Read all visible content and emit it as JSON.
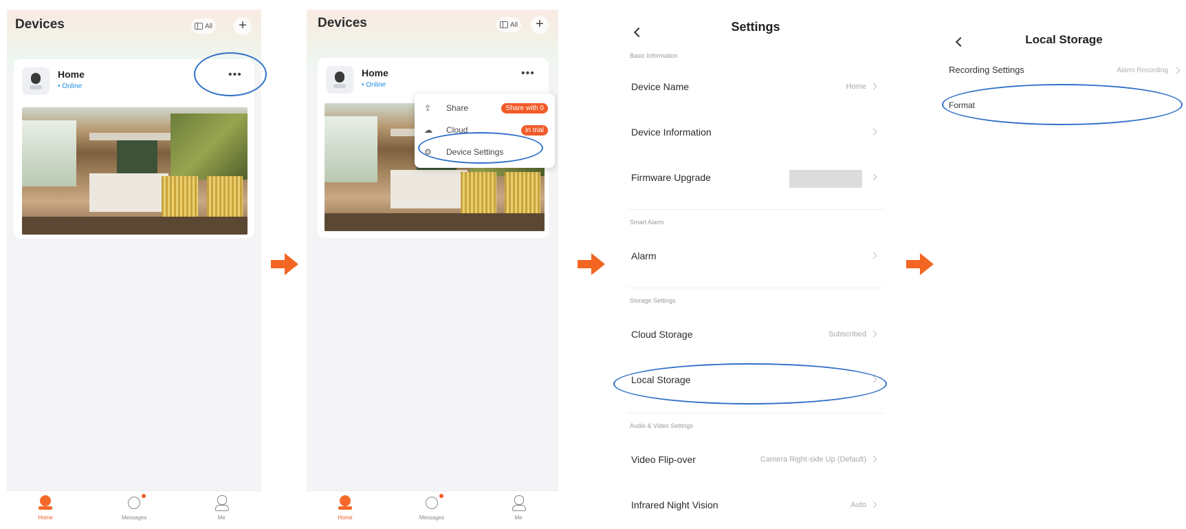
{
  "devices_screen": {
    "title": "Devices",
    "all_label": "All",
    "device": {
      "name": "Home",
      "status": "• Online"
    },
    "tabs": [
      {
        "label": "Home",
        "active": true,
        "icon": "home-camera-icon"
      },
      {
        "label": "Messages",
        "active": false,
        "icon": "message-icon",
        "unread_dot": true
      },
      {
        "label": "Me",
        "active": false,
        "icon": "profile-icon"
      }
    ]
  },
  "device_menu": {
    "items": [
      {
        "label": "Share",
        "badge": "Share with 0",
        "icon": "share-icon"
      },
      {
        "label": "Cloud",
        "badge": "In trial",
        "icon": "cloud-icon"
      },
      {
        "label": "Device Settings",
        "badge": "",
        "icon": "settings-gear-icon"
      }
    ]
  },
  "settings_screen": {
    "title": "Settings",
    "sections": {
      "basic": "Basic Information",
      "alarm": "Smart Alarm",
      "storage": "Storage Settings",
      "av": "Audio & Video Settings"
    },
    "rows": {
      "device_name": {
        "label": "Device Name",
        "value": "Home"
      },
      "device_info": {
        "label": "Device Information",
        "value": ""
      },
      "firmware": {
        "label": "Firmware Upgrade",
        "value": ""
      },
      "alarm": {
        "label": "Alarm",
        "value": ""
      },
      "cloud_storage": {
        "label": "Cloud Storage",
        "value": "Subscribed"
      },
      "local_storage": {
        "label": "Local Storage",
        "value": ""
      },
      "video_flip": {
        "label": "Video Flip-over",
        "value": "Camera Right-side Up (Default)"
      },
      "night_vision": {
        "label": "Infrared Night Vision",
        "value": "Auto"
      }
    }
  },
  "local_storage_screen": {
    "title": "Local Storage",
    "recording": {
      "label": "Recording Settings",
      "value": "Alarm Recording"
    },
    "format_label": "Format"
  },
  "colors": {
    "accent": "#f05a22",
    "highlight_ring": "#2f6fc8",
    "link": "#1a8fe3"
  }
}
